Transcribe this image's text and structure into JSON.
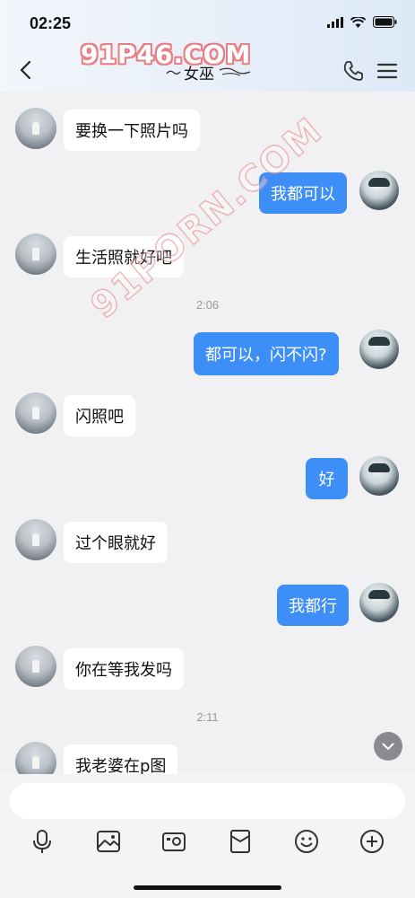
{
  "status_bar": {
    "time": "02:25"
  },
  "header": {
    "title": "女巫"
  },
  "watermarks": {
    "top": "91P46.COM",
    "diagonal": "91PORN.COM"
  },
  "messages": [
    {
      "side": "in",
      "text": "要换一下照片吗"
    },
    {
      "side": "out",
      "text": "我都可以"
    },
    {
      "side": "in",
      "text": "生活照就好吧"
    },
    {
      "type": "timestamp",
      "text": "2:06"
    },
    {
      "side": "out",
      "text": "都可以，闪不闪?"
    },
    {
      "side": "in",
      "text": "闪照吧"
    },
    {
      "side": "out",
      "text": "好"
    },
    {
      "side": "in",
      "text": "过个眼就好"
    },
    {
      "side": "out",
      "text": "我都行"
    },
    {
      "side": "in",
      "text": "你在等我发吗"
    },
    {
      "type": "timestamp",
      "text": "2:11"
    },
    {
      "side": "in",
      "text": "我老婆在p图"
    }
  ],
  "input": {
    "value": "",
    "placeholder": ""
  },
  "toolbar": [
    "microphone-icon",
    "image-icon",
    "camera-icon",
    "red-packet-icon",
    "emoji-icon",
    "plus-icon"
  ],
  "colors": {
    "outgoing_bubble": "#3d8ff7",
    "incoming_bubble": "#ffffff",
    "background": "#f1f1f3"
  }
}
